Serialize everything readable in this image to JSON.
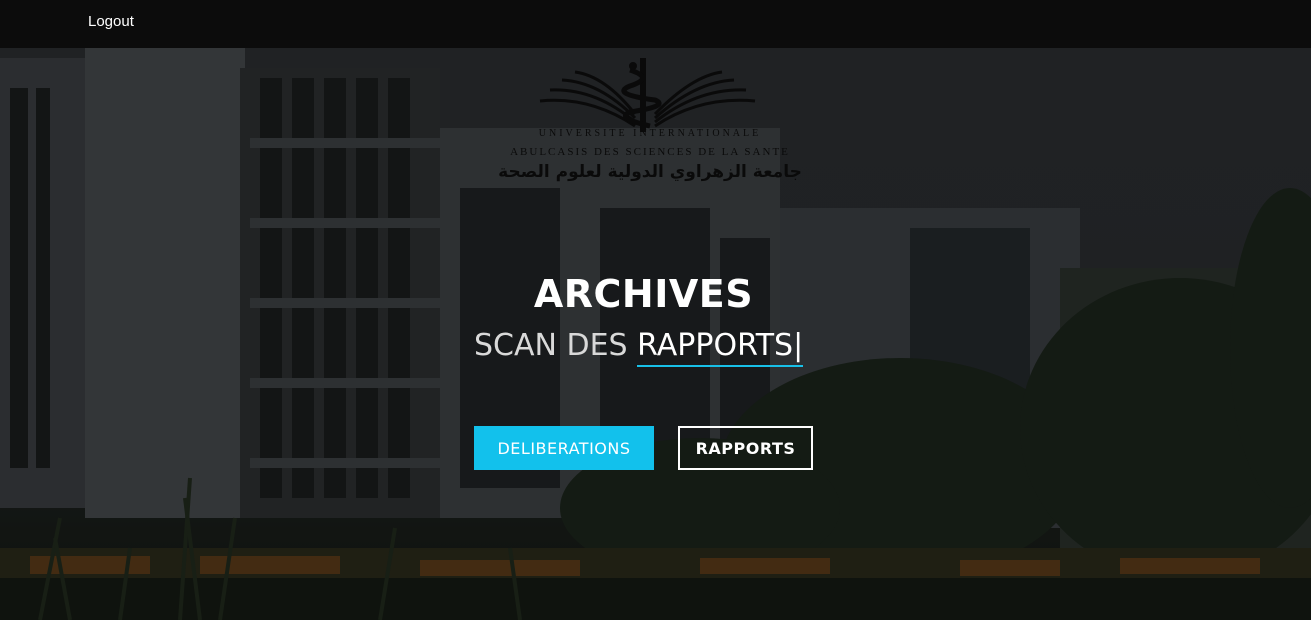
{
  "topbar": {
    "logout_label": "Logout"
  },
  "logo": {
    "line1": "UNIVERSITE INTERNATIONALE",
    "line2": "ABULCASIS DES SCIENCES DE LA SANTE",
    "line3": "جامعة الزهراوي الدولية لعلوم الصحة"
  },
  "hero": {
    "title": "ARCHIVES",
    "subtitle_prefix": "SCAN DES ",
    "subtitle_typed": "RAPPORTS",
    "cursor": "|",
    "buttons": {
      "deliberations_label": "DELIBERATIONS",
      "rapports_label": "RAPPORTS"
    }
  },
  "colors": {
    "topbar_bg": "#0c0c0c",
    "accent": "#12c1ec",
    "typed_underline": "#18c0e8"
  }
}
